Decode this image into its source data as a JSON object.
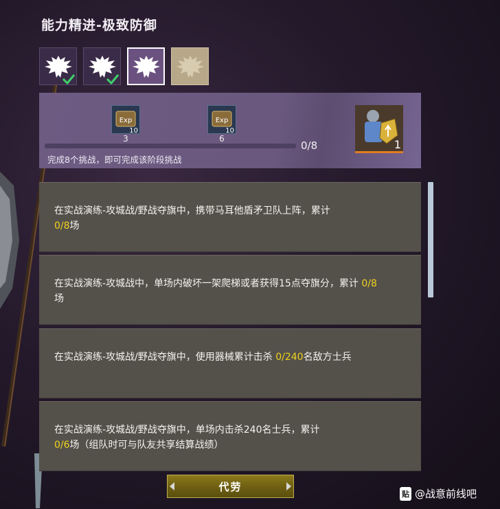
{
  "title": "能力精进-极致防御",
  "stages": [
    {
      "state": "done",
      "icon": "eagle-emblem-icon"
    },
    {
      "state": "done",
      "icon": "eagle-emblem-icon"
    },
    {
      "state": "active",
      "icon": "eagle-emblem-icon"
    },
    {
      "state": "locked",
      "icon": "eagle-emblem-icon"
    }
  ],
  "rewards": {
    "items": [
      {
        "icon": "exp-scroll-icon",
        "badge": "10",
        "label": "3"
      },
      {
        "icon": "exp-scroll-icon",
        "badge": "10",
        "label": "6"
      }
    ],
    "progress_text": "0/8",
    "progress_fraction": 0,
    "hint": "完成8个挑战，即可完成该阶段挑战",
    "final": {
      "icon": "shield-knight-icon",
      "count": "1"
    }
  },
  "tasks": [
    {
      "pre": "在实战演练-攻城战/野战夺旗中，携带马耳他盾矛卫队上阵，累计",
      "hl": "0/8",
      "post": "场"
    },
    {
      "pre": "在实战演练-攻城战中，单场内破坏一架爬梯或者获得15点夺旗分，累计 ",
      "hl": "0/8",
      "post": "场"
    },
    {
      "pre": "在实战演练-攻城战/野战夺旗中，使用器械累计击杀 ",
      "hl": "0/240",
      "post": "名敌方士兵"
    },
    {
      "pre": "在实战演练-攻城战/野战夺旗中，单场内击杀240名士兵，累计",
      "hl": "0/6",
      "post": "场（组队时可与队友共享结算战绩）"
    }
  ],
  "button_label": "代劳",
  "watermark": {
    "badge": "贴",
    "text": "@战意前线吧"
  },
  "colors": {
    "highlight": "#f0d21f",
    "panel": "#6d5b82",
    "task_bg": "#54514b",
    "button": "#7a6a16"
  }
}
